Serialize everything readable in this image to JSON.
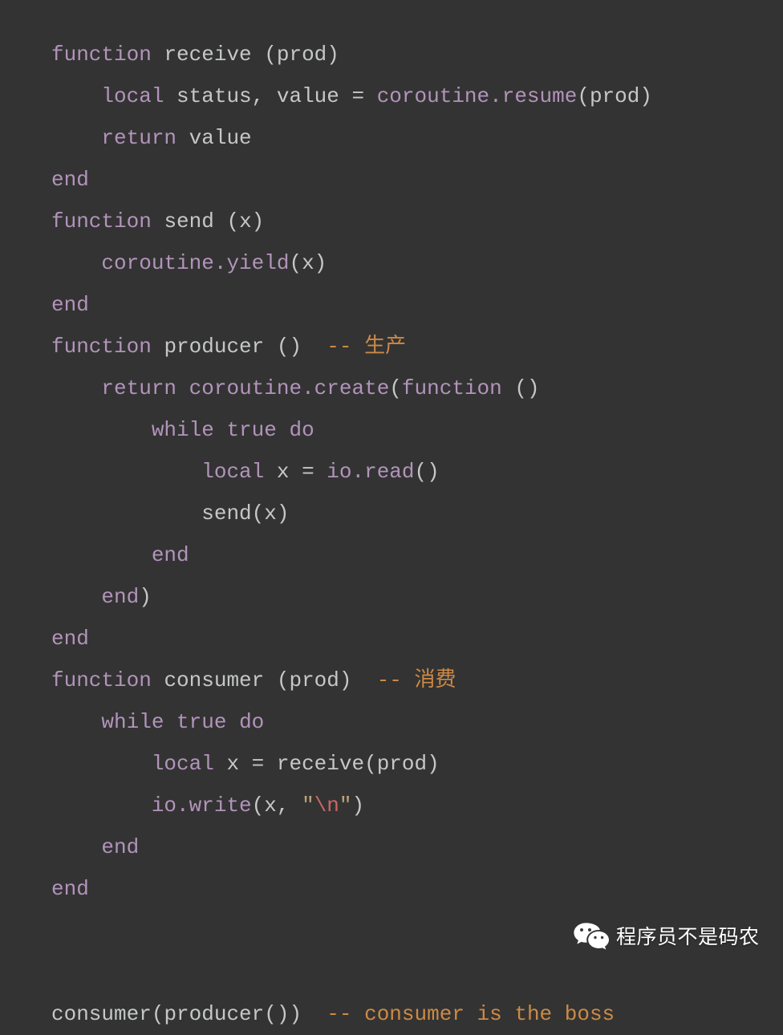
{
  "editor": {
    "background_color": "#333333",
    "language": "lua",
    "colors": {
      "keyword": "#b294bb",
      "identifier": "#c5c8c6",
      "comment": "#cc8a46",
      "string": "#c0a375",
      "escape": "#cc6666"
    }
  },
  "code_lines": [
    {
      "indent": 0,
      "tokens": [
        {
          "t": "function",
          "c": "kw"
        },
        {
          "t": " ",
          "c": "id"
        },
        {
          "t": "receive",
          "c": "id"
        },
        {
          "t": " (prod)",
          "c": "punc"
        }
      ]
    },
    {
      "indent": 4,
      "tokens": [
        {
          "t": "local",
          "c": "kw"
        },
        {
          "t": " status, value ",
          "c": "id"
        },
        {
          "t": "=",
          "c": "punc"
        },
        {
          "t": " ",
          "c": "id"
        },
        {
          "t": "coroutine.resume",
          "c": "kw"
        },
        {
          "t": "(prod)",
          "c": "punc"
        }
      ]
    },
    {
      "indent": 4,
      "tokens": [
        {
          "t": "return",
          "c": "kw"
        },
        {
          "t": " value",
          "c": "id"
        }
      ]
    },
    {
      "indent": 0,
      "tokens": [
        {
          "t": "end",
          "c": "kw"
        }
      ]
    },
    {
      "indent": 0,
      "tokens": [
        {
          "t": "function",
          "c": "kw"
        },
        {
          "t": " ",
          "c": "id"
        },
        {
          "t": "send",
          "c": "id"
        },
        {
          "t": " (x)",
          "c": "punc"
        }
      ]
    },
    {
      "indent": 4,
      "tokens": [
        {
          "t": "coroutine.yield",
          "c": "kw"
        },
        {
          "t": "(x)",
          "c": "punc"
        }
      ]
    },
    {
      "indent": 0,
      "tokens": [
        {
          "t": "end",
          "c": "kw"
        }
      ]
    },
    {
      "indent": 0,
      "tokens": [
        {
          "t": "function",
          "c": "kw"
        },
        {
          "t": " ",
          "c": "id"
        },
        {
          "t": "producer",
          "c": "id"
        },
        {
          "t": " ()",
          "c": "punc"
        },
        {
          "t": "  ",
          "c": "id"
        },
        {
          "t": "-- 生产",
          "c": "com"
        }
      ]
    },
    {
      "indent": 4,
      "tokens": [
        {
          "t": "return",
          "c": "kw"
        },
        {
          "t": " ",
          "c": "id"
        },
        {
          "t": "coroutine.create",
          "c": "kw"
        },
        {
          "t": "(",
          "c": "punc"
        },
        {
          "t": "function",
          "c": "kw"
        },
        {
          "t": " ()",
          "c": "punc"
        }
      ]
    },
    {
      "indent": 8,
      "tokens": [
        {
          "t": "while",
          "c": "kw"
        },
        {
          "t": " ",
          "c": "id"
        },
        {
          "t": "true",
          "c": "kw"
        },
        {
          "t": " ",
          "c": "id"
        },
        {
          "t": "do",
          "c": "kw"
        }
      ]
    },
    {
      "indent": 12,
      "tokens": [
        {
          "t": "local",
          "c": "kw"
        },
        {
          "t": " x ",
          "c": "id"
        },
        {
          "t": "=",
          "c": "punc"
        },
        {
          "t": " ",
          "c": "id"
        },
        {
          "t": "io.read",
          "c": "kw"
        },
        {
          "t": "()",
          "c": "punc"
        }
      ]
    },
    {
      "indent": 12,
      "tokens": [
        {
          "t": "send",
          "c": "id"
        },
        {
          "t": "(x)",
          "c": "punc"
        }
      ]
    },
    {
      "indent": 8,
      "tokens": [
        {
          "t": "end",
          "c": "kw"
        }
      ]
    },
    {
      "indent": 4,
      "tokens": [
        {
          "t": "end",
          "c": "kw"
        },
        {
          "t": ")",
          "c": "punc"
        }
      ]
    },
    {
      "indent": 0,
      "tokens": [
        {
          "t": "end",
          "c": "kw"
        }
      ]
    },
    {
      "indent": 0,
      "tokens": [
        {
          "t": "function",
          "c": "kw"
        },
        {
          "t": " ",
          "c": "id"
        },
        {
          "t": "consumer",
          "c": "id"
        },
        {
          "t": " (prod)",
          "c": "punc"
        },
        {
          "t": "  ",
          "c": "id"
        },
        {
          "t": "-- 消费",
          "c": "com"
        }
      ]
    },
    {
      "indent": 4,
      "tokens": [
        {
          "t": "while",
          "c": "kw"
        },
        {
          "t": " ",
          "c": "id"
        },
        {
          "t": "true",
          "c": "kw"
        },
        {
          "t": " ",
          "c": "id"
        },
        {
          "t": "do",
          "c": "kw"
        }
      ]
    },
    {
      "indent": 8,
      "tokens": [
        {
          "t": "local",
          "c": "kw"
        },
        {
          "t": " x ",
          "c": "id"
        },
        {
          "t": "=",
          "c": "punc"
        },
        {
          "t": " ",
          "c": "id"
        },
        {
          "t": "receive",
          "c": "id"
        },
        {
          "t": "(prod)",
          "c": "punc"
        }
      ]
    },
    {
      "indent": 8,
      "tokens": [
        {
          "t": "io.write",
          "c": "kw"
        },
        {
          "t": "(x, ",
          "c": "punc"
        },
        {
          "t": "\"",
          "c": "str"
        },
        {
          "t": "\\n",
          "c": "esc"
        },
        {
          "t": "\"",
          "c": "str"
        },
        {
          "t": ")",
          "c": "punc"
        }
      ]
    },
    {
      "indent": 4,
      "tokens": [
        {
          "t": "end",
          "c": "kw"
        }
      ]
    },
    {
      "indent": 0,
      "tokens": [
        {
          "t": "end",
          "c": "kw"
        }
      ]
    },
    {
      "indent": 0,
      "tokens": []
    },
    {
      "indent": 0,
      "tokens": []
    },
    {
      "indent": 0,
      "tokens": [
        {
          "t": "consumer",
          "c": "id"
        },
        {
          "t": "(",
          "c": "punc"
        },
        {
          "t": "producer",
          "c": "id"
        },
        {
          "t": "())",
          "c": "punc"
        },
        {
          "t": "  ",
          "c": "id"
        },
        {
          "t": "-- consumer is the boss",
          "c": "com"
        }
      ]
    }
  ],
  "watermark": {
    "icon": "wechat-logo-icon",
    "text": "程序员不是码农"
  }
}
